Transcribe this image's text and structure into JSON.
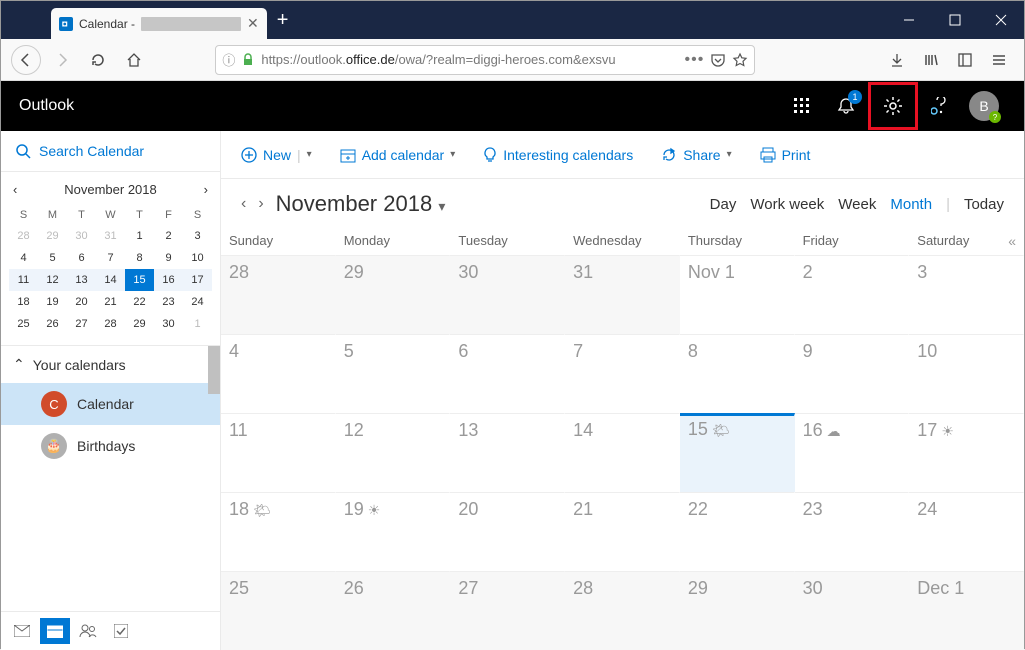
{
  "browser": {
    "tab_title": "Calendar - ",
    "url_display_pre": "https://outlook.",
    "url_display_bold": "office.de",
    "url_display_post": "/owa/?realm=diggi-heroes.com&exsvu"
  },
  "owa": {
    "brand": "Outlook",
    "notification_count": "1",
    "avatar_letter": "B"
  },
  "sidebar": {
    "search_placeholder": "Search Calendar",
    "mini_month": "November 2018",
    "dow": [
      "S",
      "M",
      "T",
      "W",
      "T",
      "F",
      "S"
    ],
    "days": [
      {
        "n": "28",
        "cls": "other"
      },
      {
        "n": "29",
        "cls": "other"
      },
      {
        "n": "30",
        "cls": "other"
      },
      {
        "n": "31",
        "cls": "other"
      },
      {
        "n": "1",
        "cls": ""
      },
      {
        "n": "2",
        "cls": ""
      },
      {
        "n": "3",
        "cls": ""
      },
      {
        "n": "4",
        "cls": ""
      },
      {
        "n": "5",
        "cls": ""
      },
      {
        "n": "6",
        "cls": ""
      },
      {
        "n": "7",
        "cls": ""
      },
      {
        "n": "8",
        "cls": ""
      },
      {
        "n": "9",
        "cls": ""
      },
      {
        "n": "10",
        "cls": ""
      },
      {
        "n": "11",
        "cls": "wk"
      },
      {
        "n": "12",
        "cls": "wk"
      },
      {
        "n": "13",
        "cls": "wk"
      },
      {
        "n": "14",
        "cls": "wk"
      },
      {
        "n": "15",
        "cls": "sel"
      },
      {
        "n": "16",
        "cls": "wk"
      },
      {
        "n": "17",
        "cls": "wk"
      },
      {
        "n": "18",
        "cls": ""
      },
      {
        "n": "19",
        "cls": ""
      },
      {
        "n": "20",
        "cls": ""
      },
      {
        "n": "21",
        "cls": ""
      },
      {
        "n": "22",
        "cls": ""
      },
      {
        "n": "23",
        "cls": ""
      },
      {
        "n": "24",
        "cls": ""
      },
      {
        "n": "25",
        "cls": ""
      },
      {
        "n": "26",
        "cls": ""
      },
      {
        "n": "27",
        "cls": ""
      },
      {
        "n": "28",
        "cls": ""
      },
      {
        "n": "29",
        "cls": ""
      },
      {
        "n": "30",
        "cls": ""
      },
      {
        "n": "1",
        "cls": "other"
      }
    ],
    "your_calendars": "Your calendars",
    "calendars": [
      {
        "label": "Calendar",
        "color": "#d14b2a",
        "letter": "C",
        "active": true
      },
      {
        "label": "Birthdays",
        "color": "#b0b0b0",
        "letter": "🎂",
        "active": false
      }
    ]
  },
  "toolbar": {
    "new": "New",
    "add_cal": "Add calendar",
    "interesting": "Interesting calendars",
    "share": "Share",
    "print": "Print"
  },
  "main": {
    "month_title": "November 2018",
    "views": {
      "day": "Day",
      "workweek": "Work week",
      "week": "Week",
      "month": "Month",
      "today": "Today"
    },
    "dow": [
      "Sunday",
      "Monday",
      "Tuesday",
      "Wednesday",
      "Thursday",
      "Friday",
      "Saturday"
    ],
    "cells": [
      {
        "t": "28",
        "cls": "other"
      },
      {
        "t": "29",
        "cls": "other"
      },
      {
        "t": "30",
        "cls": "other"
      },
      {
        "t": "31",
        "cls": "other"
      },
      {
        "t": "Nov 1",
        "cls": ""
      },
      {
        "t": "2",
        "cls": ""
      },
      {
        "t": "3",
        "cls": ""
      },
      {
        "t": "4",
        "cls": ""
      },
      {
        "t": "5",
        "cls": ""
      },
      {
        "t": "6",
        "cls": ""
      },
      {
        "t": "7",
        "cls": ""
      },
      {
        "t": "8",
        "cls": ""
      },
      {
        "t": "9",
        "cls": ""
      },
      {
        "t": "10",
        "cls": ""
      },
      {
        "t": "11",
        "cls": ""
      },
      {
        "t": "12",
        "cls": ""
      },
      {
        "t": "13",
        "cls": ""
      },
      {
        "t": "14",
        "cls": ""
      },
      {
        "t": "15",
        "cls": "today",
        "w": "🌤"
      },
      {
        "t": "16",
        "cls": "",
        "w": "☁"
      },
      {
        "t": "17",
        "cls": "",
        "w": "☀"
      },
      {
        "t": "18",
        "cls": "",
        "w": "🌤"
      },
      {
        "t": "19",
        "cls": "",
        "w": "☀"
      },
      {
        "t": "20",
        "cls": ""
      },
      {
        "t": "21",
        "cls": ""
      },
      {
        "t": "22",
        "cls": ""
      },
      {
        "t": "23",
        "cls": ""
      },
      {
        "t": "24",
        "cls": ""
      },
      {
        "t": "25",
        "cls": "other"
      },
      {
        "t": "26",
        "cls": "other"
      },
      {
        "t": "27",
        "cls": "other"
      },
      {
        "t": "28",
        "cls": "other"
      },
      {
        "t": "29",
        "cls": "other"
      },
      {
        "t": "30",
        "cls": "other"
      },
      {
        "t": "Dec 1",
        "cls": "other"
      }
    ]
  }
}
